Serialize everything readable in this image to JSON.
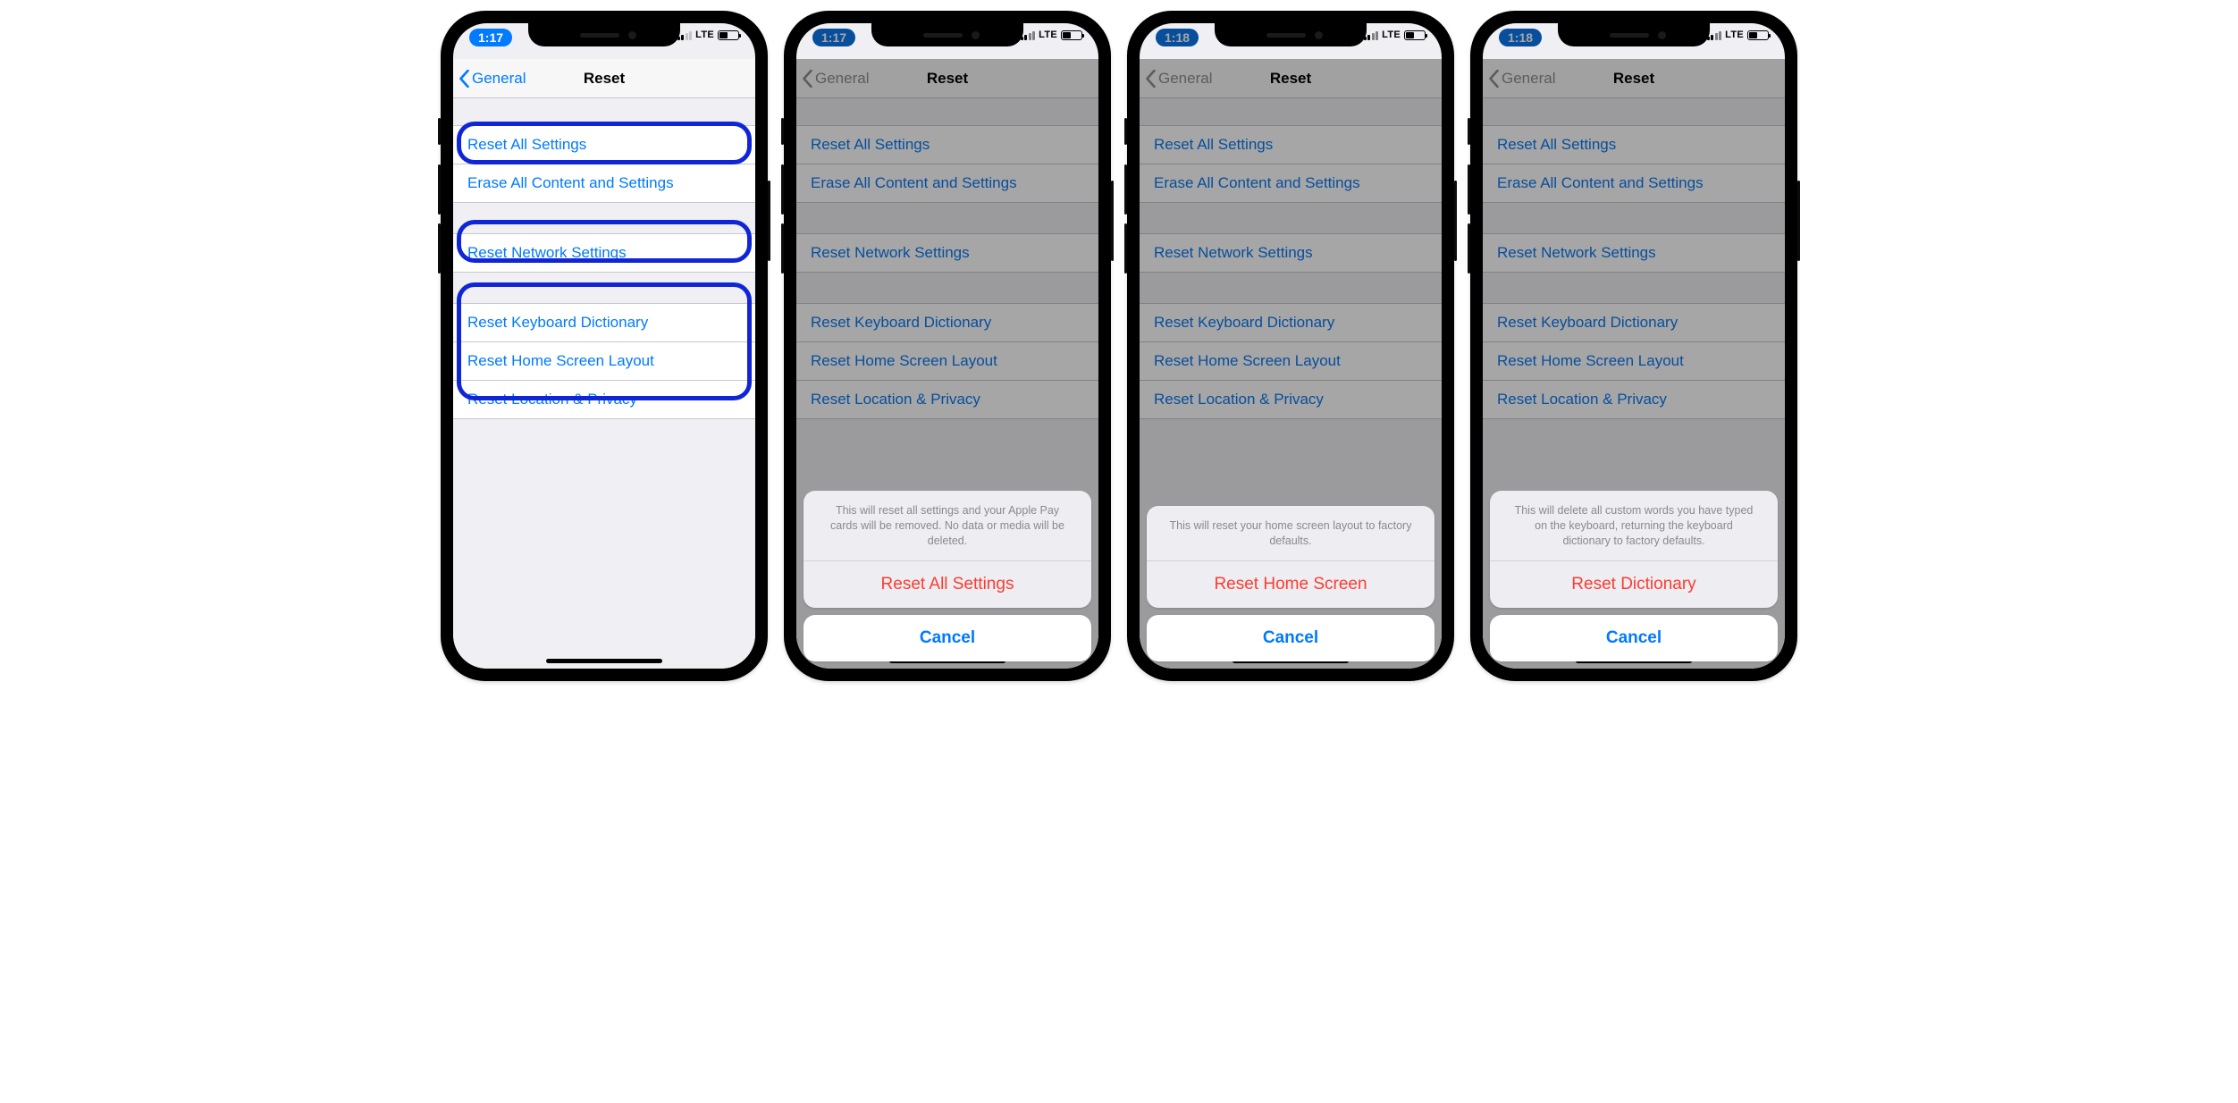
{
  "colors": {
    "accent": "#007aff",
    "destructive": "#ff3b30",
    "highlight": "#1026d6"
  },
  "status": {
    "carrier": "LTE"
  },
  "nav": {
    "back_label": "General",
    "title": "Reset"
  },
  "reset": {
    "group1": [
      {
        "label": "Reset All Settings"
      },
      {
        "label": "Erase All Content and Settings"
      }
    ],
    "group2": [
      {
        "label": "Reset Network Settings"
      }
    ],
    "group3": [
      {
        "label": "Reset Keyboard Dictionary"
      },
      {
        "label": "Reset Home Screen Layout"
      },
      {
        "label": "Reset Location & Privacy"
      }
    ]
  },
  "phones": [
    {
      "time": "1:17",
      "dimmed": false,
      "highlights": true,
      "sheet": null
    },
    {
      "time": "1:17",
      "dimmed": true,
      "highlights": false,
      "sheet": {
        "message": "This will reset all settings and your Apple Pay cards will be removed. No data or media will be deleted.",
        "action": "Reset All Settings",
        "cancel": "Cancel"
      }
    },
    {
      "time": "1:18",
      "dimmed": true,
      "highlights": false,
      "sheet": {
        "message": "This will reset your home screen layout to factory defaults.",
        "action": "Reset Home Screen",
        "cancel": "Cancel"
      }
    },
    {
      "time": "1:18",
      "dimmed": true,
      "highlights": false,
      "sheet": {
        "message": "This will delete all custom words you have typed on the keyboard, returning the keyboard dictionary to factory defaults.",
        "action": "Reset Dictionary",
        "cancel": "Cancel"
      }
    }
  ]
}
